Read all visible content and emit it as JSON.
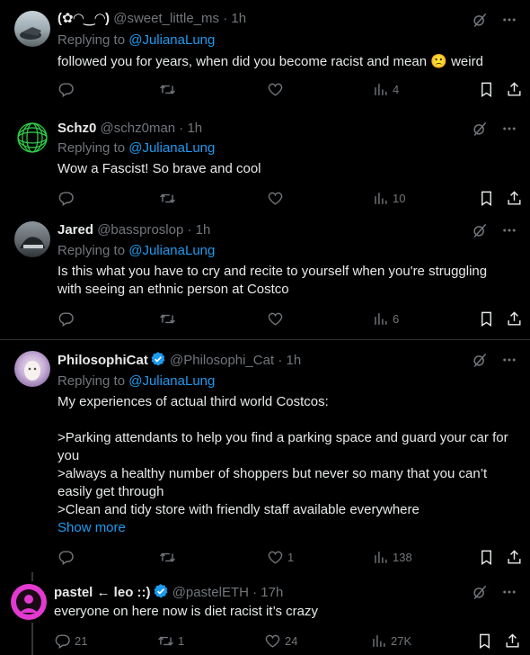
{
  "replying_prefix": "Replying to",
  "mention": "@JulianaLung",
  "tweets": [
    {
      "name": "(✿◠‿◠)",
      "handle": "@sweet_little_ms",
      "time": "1h",
      "text_lines": [
        "followed you for years, when did you become racist and mean 🙁 weird"
      ],
      "views": "4"
    },
    {
      "name": "Schz0",
      "handle": "@schz0man",
      "time": "1h",
      "text_lines": [
        "Wow a Fascist! So brave and cool"
      ],
      "views": "10"
    },
    {
      "name": "Jared",
      "handle": "@bassproslop",
      "time": "1h",
      "text_lines": [
        "Is this what you have to cry and recite to yourself when you're struggling",
        "with seeing an ethnic person at Costco"
      ],
      "views": "6"
    },
    {
      "name": "PhilosophiCat",
      "handle": "@Philosophi_Cat",
      "time": "1h",
      "text_lines": [
        "My experiences of actual third world Costcos:",
        "",
        ">Parking attendants to help you find a parking space and guard your car for",
        "you",
        ">always a healthy number of shoppers but never so many that you can’t",
        "easily get through",
        ">Clean and tidy store with friendly staff available everywhere"
      ],
      "show_more": "Show more",
      "likes": "1",
      "views": "138"
    },
    {
      "name": "pastel ← leo ::)",
      "handle": "@pastelETH",
      "time": "17h",
      "text_lines": [
        "everyone on here now is diet racist it’s crazy"
      ],
      "replies": "21",
      "reposts": "1",
      "likes": "24",
      "views": "27K"
    }
  ],
  "separator": "·"
}
